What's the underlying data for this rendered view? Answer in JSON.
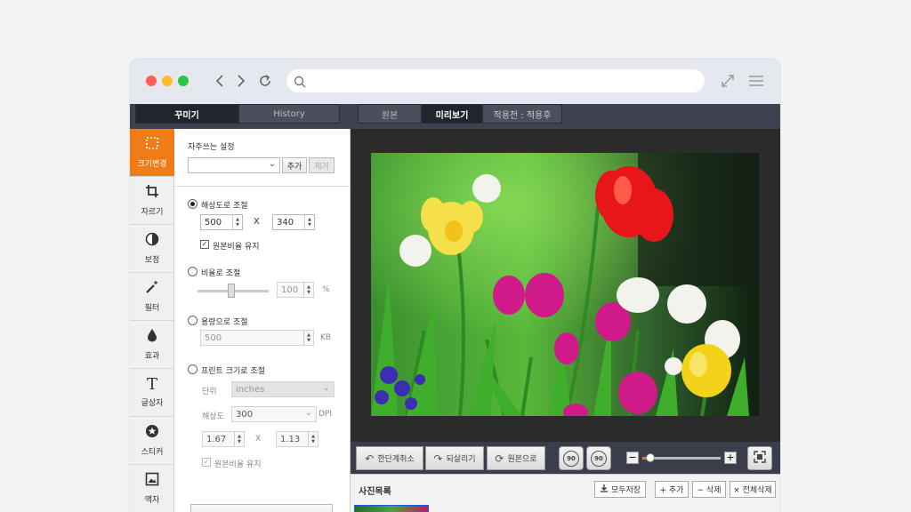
{
  "browser": {
    "dots": [
      "#ff5f57",
      "#febc2e",
      "#28c840"
    ],
    "address_value": ""
  },
  "app": {
    "tabs": {
      "decorate": "꾸미기",
      "history": "History"
    },
    "view_tabs": {
      "original": "원본",
      "preview": "미리보기",
      "compare": "적용전 : 적용후"
    }
  },
  "sidebar": {
    "items": [
      {
        "label": "크기변경",
        "icon": "resize-icon",
        "active": true
      },
      {
        "label": "자르기",
        "icon": "crop-icon"
      },
      {
        "label": "보정",
        "icon": "contrast-icon"
      },
      {
        "label": "필터",
        "icon": "magic-wand-icon"
      },
      {
        "label": "효과",
        "icon": "drop-icon"
      },
      {
        "label": "글상자",
        "icon": "text-icon"
      },
      {
        "label": "스티커",
        "icon": "star-badge-icon"
      },
      {
        "label": "액자",
        "icon": "frame-icon"
      }
    ],
    "accent": "#f07c18"
  },
  "panel": {
    "favorites_title": "자주쓰는 설정",
    "add_button": "추가",
    "remove_button": "제거",
    "resolution_label": "해상도로 조절",
    "width_value": "500",
    "height_value": "340",
    "x_sep": "X",
    "keep_ratio": "원본비율 유지",
    "ratio_label": "비율로 조절",
    "ratio_value": "100",
    "ratio_unit": "%",
    "size_label": "용량으로 조절",
    "size_value": "500",
    "size_unit": "KB",
    "print_label": "프린트 크기로 조절",
    "unit_label": "단위",
    "unit_value": "inches",
    "dpi_label": "해상도",
    "dpi_value": "300",
    "dpi_unit": "DPI",
    "print_w": "1.67",
    "print_h": "1.13",
    "print_x": "X",
    "print_keep_ratio": "원본비율 유지"
  },
  "toolbar": {
    "undo": "한단계취소",
    "redo": "되살리기",
    "restore": "원본으로",
    "rotate_left": "90",
    "rotate_right": "90",
    "zoom_minus": "−",
    "zoom_plus": "+",
    "zoom_level": 0.1
  },
  "photo_list": {
    "title": "사진목록",
    "save_all": "모두저장",
    "add": "+ 추가",
    "delete": "− 삭제",
    "delete_all": "× 전체삭제"
  }
}
